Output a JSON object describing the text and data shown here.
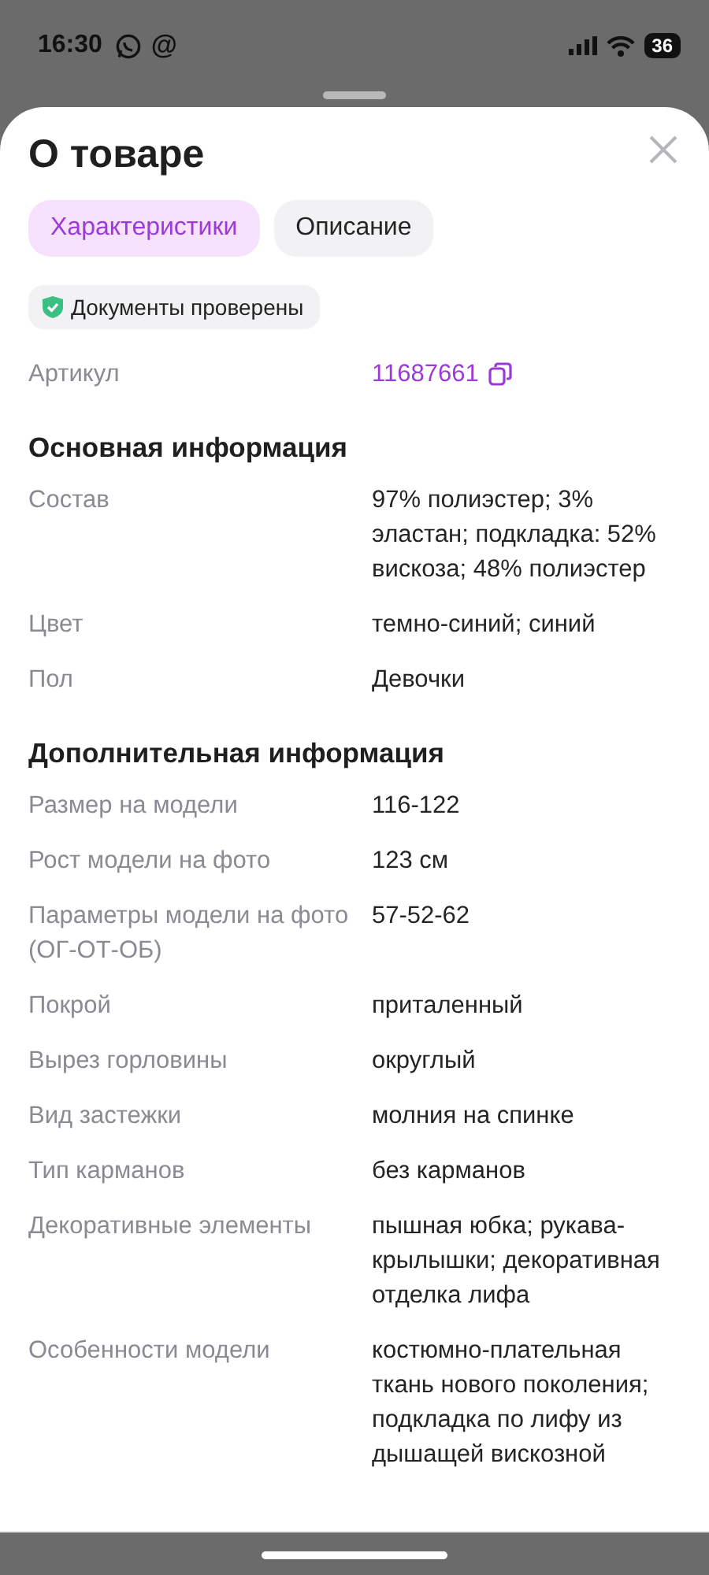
{
  "status_bar": {
    "time": "16:30",
    "notification_glyph": "@",
    "battery": "36"
  },
  "sheet": {
    "title": "О товаре",
    "tabs": [
      {
        "label": "Характеристики",
        "selected": true
      },
      {
        "label": "Описание",
        "selected": false
      }
    ],
    "badge": {
      "label": "Документы проверены"
    },
    "article": {
      "label": "Артикул",
      "value": "11687661"
    },
    "sections": [
      {
        "heading": "Основная информация",
        "rows": [
          {
            "label": "Состав",
            "value": "97% полиэстер; 3% эластан; подкладка: 52% вискоза; 48% полиэстер"
          },
          {
            "label": "Цвет",
            "value": "темно-синий; синий"
          },
          {
            "label": "Пол",
            "value": "Девочки"
          }
        ]
      },
      {
        "heading": "Дополнительная информация",
        "rows": [
          {
            "label": "Размер на модели",
            "value": "116-122"
          },
          {
            "label": "Рост модели на фото",
            "value": "123 см"
          },
          {
            "label": "Параметры модели на фото (ОГ-ОТ-ОБ)",
            "value": "57-52-62"
          },
          {
            "label": "Покрой",
            "value": "приталенный"
          },
          {
            "label": "Вырез горловины",
            "value": "округлый"
          },
          {
            "label": "Вид застежки",
            "value": "молния на спинке"
          },
          {
            "label": "Тип карманов",
            "value": "без карманов"
          },
          {
            "label": "Декоративные элементы",
            "value": "пышная юбка; рукава-крылышки; декоративная отделка лифа"
          },
          {
            "label": "Особенности модели",
            "value": "костюмно-плательная ткань нового поколения; подкладка по лифу из дышащей вискозной"
          }
        ]
      }
    ]
  }
}
